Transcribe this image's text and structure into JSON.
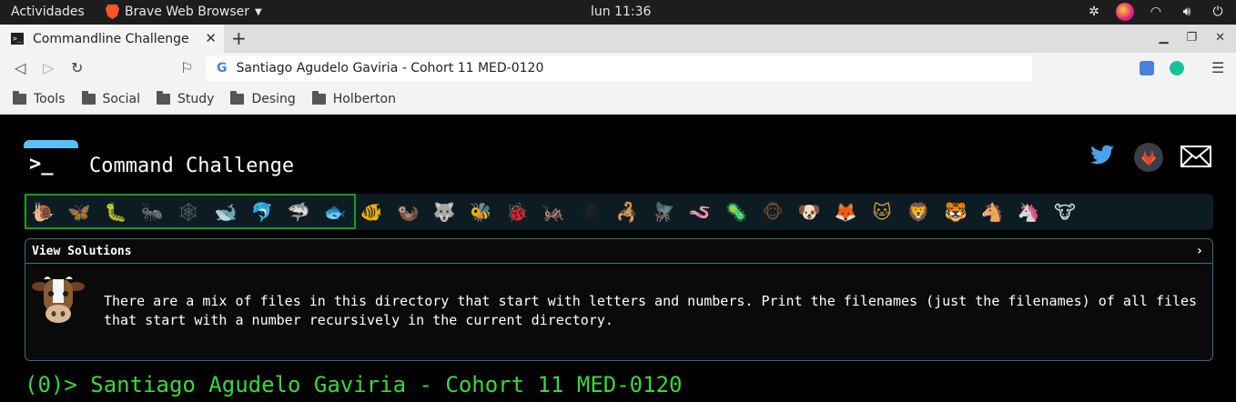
{
  "system_bar": {
    "activities": "Actividades",
    "app_name": "Brave Web Browser",
    "clock": "lun 11:36"
  },
  "browser": {
    "tab_title": "Commandline Challenge",
    "address": "Santiago Agudelo Gaviria - Cohort 11 MED-0120",
    "bookmarks": [
      "Tools",
      "Social",
      "Study",
      "Desing",
      "Holberton"
    ]
  },
  "site": {
    "logo_prompt": ">_",
    "title": "Command Challenge"
  },
  "animals": [
    {
      "name": "snail",
      "glyph": "🐌",
      "color": "#8a6b3a"
    },
    {
      "name": "butterfly",
      "glyph": "🦋",
      "color": "#d96a1e"
    },
    {
      "name": "caterpillar",
      "glyph": "🐛",
      "color": "#7bbf2a"
    },
    {
      "name": "ant",
      "glyph": "🐜",
      "color": "#222"
    },
    {
      "name": "spider-web",
      "glyph": "🕸",
      "color": "#666"
    },
    {
      "name": "whale",
      "glyph": "🐋",
      "color": "#2e7cc4"
    },
    {
      "name": "dolphin",
      "glyph": "🐬",
      "color": "#3d86c9"
    },
    {
      "name": "shark",
      "glyph": "🦈",
      "color": "#8c9aa6"
    },
    {
      "name": "fish",
      "glyph": "🐟",
      "color": "#3fa6df"
    },
    {
      "name": "tropical-fish",
      "glyph": "🐠",
      "color": "#f2c200"
    },
    {
      "name": "otter",
      "glyph": "🦦",
      "color": "#7b5a3c"
    },
    {
      "name": "wolf",
      "glyph": "🐺",
      "color": "#9aa0a6"
    },
    {
      "name": "bee",
      "glyph": "🐝",
      "color": "#f0c419"
    },
    {
      "name": "ladybug",
      "glyph": "🐞",
      "color": "#d92b2b"
    },
    {
      "name": "cricket",
      "glyph": "🦗",
      "color": "#4c9a2a"
    },
    {
      "name": "spider",
      "glyph": "🕷",
      "color": "#222"
    },
    {
      "name": "scorpion",
      "glyph": "🦂",
      "color": "#b8341b"
    },
    {
      "name": "fly",
      "glyph": "🪰",
      "color": "#555"
    },
    {
      "name": "worm",
      "glyph": "🪱",
      "color": "#c2607a"
    },
    {
      "name": "microbe",
      "glyph": "🦠",
      "color": "#6db3e8"
    },
    {
      "name": "monkey",
      "glyph": "🐵",
      "color": "#6b4a2e"
    },
    {
      "name": "dog",
      "glyph": "🐶",
      "color": "#c98a3c"
    },
    {
      "name": "fox",
      "glyph": "🦊",
      "color": "#e06a1c"
    },
    {
      "name": "cat",
      "glyph": "🐱",
      "color": "#e0a44a"
    },
    {
      "name": "lion",
      "glyph": "🦁",
      "color": "#d9952a"
    },
    {
      "name": "tiger",
      "glyph": "🐯",
      "color": "#e8851c"
    },
    {
      "name": "horse",
      "glyph": "🐴",
      "color": "#7a4a22"
    },
    {
      "name": "unicorn",
      "glyph": "🦄",
      "color": "#dfe6ee"
    },
    {
      "name": "cow",
      "glyph": "🐮",
      "color": "#f2f2f2"
    }
  ],
  "completed_count": 9,
  "panel": {
    "header": "View Solutions",
    "chevron": "›",
    "task": "There are a mix of files in this directory that start with letters and numbers. Print the filenames (just the filenames) of all files that start with a number recursively in the current directory."
  },
  "prompt": {
    "text": "(0)> Santiago Agudelo Gaviria - Cohort 11 MED-0120"
  },
  "colors": {
    "accent_blue": "#5bc0f8",
    "success_green": "#3ad83a",
    "panel_border": "#3a6d7c"
  }
}
